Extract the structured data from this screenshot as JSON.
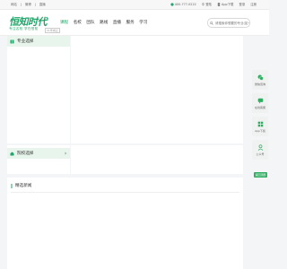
{
  "topbar": {
    "links": [
      "网站",
      "|",
      "微博",
      "|",
      "直播"
    ],
    "phone": "400-777-0222",
    "login": "中 登陆",
    "app": "App下载",
    "register": "登录",
    "about": "注册"
  },
  "header": {
    "logo": "恒知时代",
    "slogan": "专注名校 学在恒知",
    "tag": "21年成立",
    "nav": [
      "课程",
      "名校",
      "团队",
      "路线",
      "直播",
      "服务",
      "学习"
    ],
    "search_placeholder": "请搜索你想要的专业(如一起)"
  },
  "sections": {
    "major": "专业选择",
    "school": "院校选择",
    "news": "精选新闻"
  },
  "sidebar": {
    "items": [
      "微信咨询",
      "在线客服",
      "App下载",
      "公众号"
    ],
    "top": "返回顶部"
  },
  "colors": {
    "brand": "#22a56a",
    "accent": "#2fae62"
  }
}
